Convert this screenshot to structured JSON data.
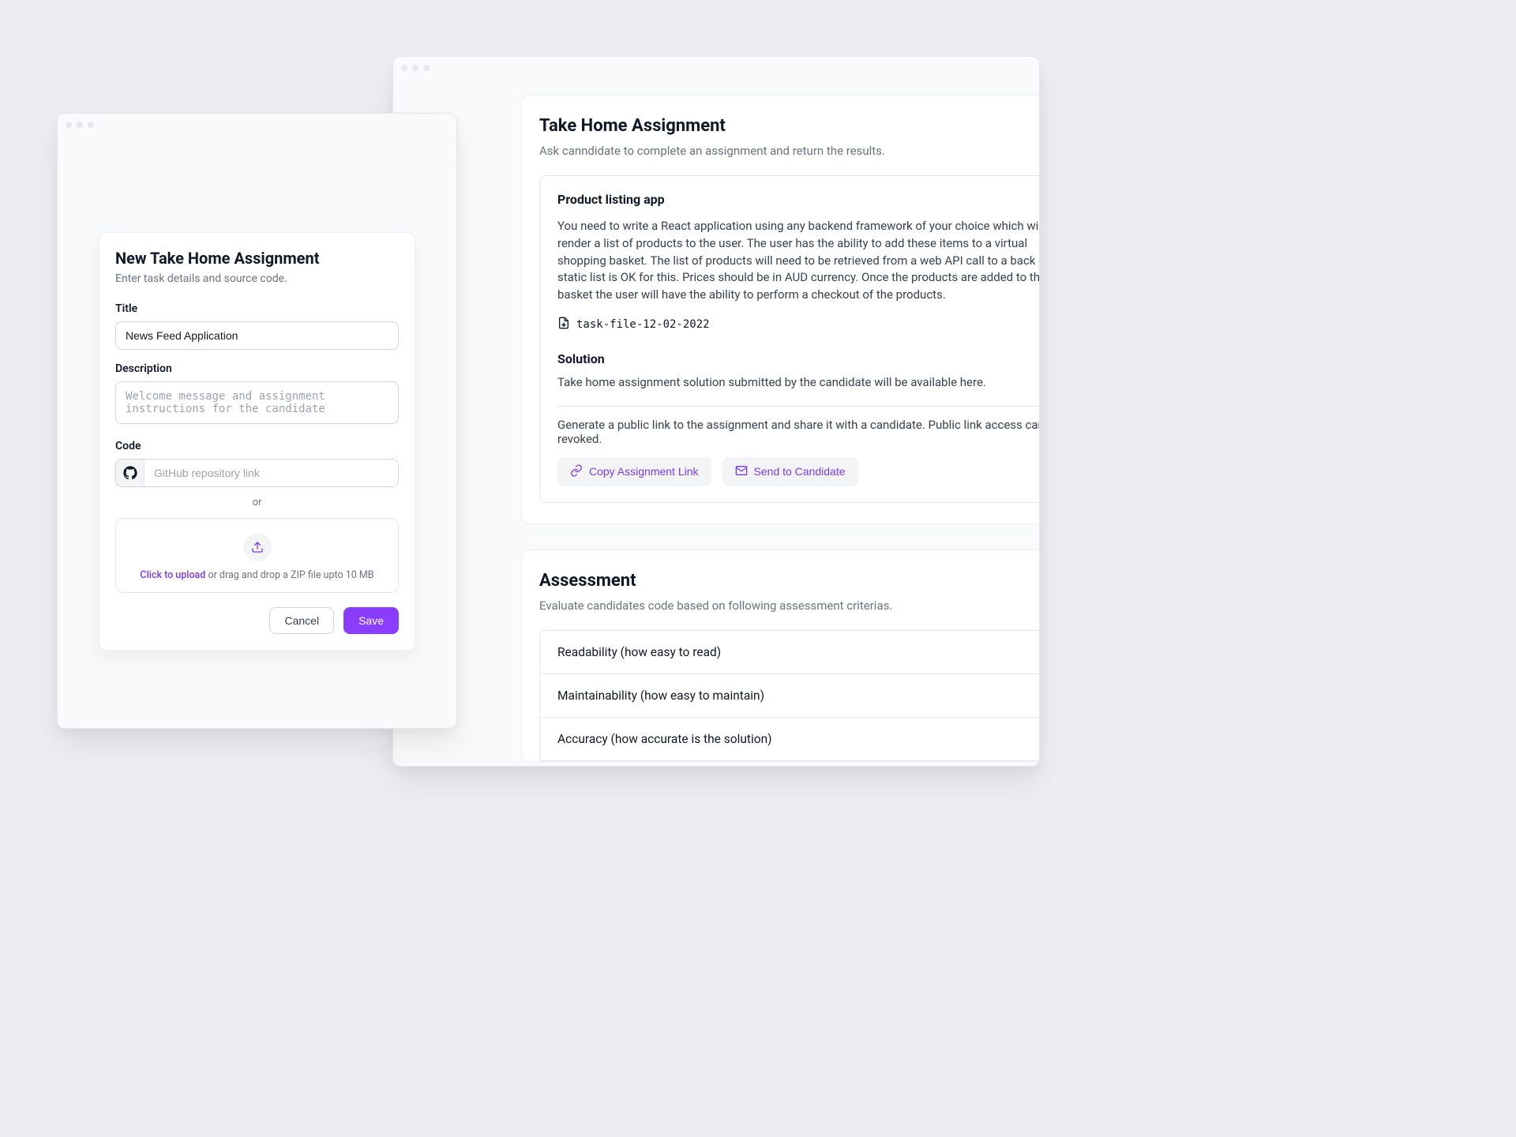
{
  "left_window": {
    "card": {
      "title": "New Take Home Assignment",
      "subtitle": "Enter task details and source code.",
      "title_field": {
        "label": "Title",
        "value": "News Feed Application"
      },
      "description_field": {
        "label": "Description",
        "placeholder": "Welcome message and assignment instructions for the candidate"
      },
      "code_field": {
        "label": "Code",
        "github_placeholder": "GitHub repository link",
        "or_text": "or",
        "upload_link_text": "Click to upload",
        "upload_rest_text": " or drag and drop a ZIP file upto 10 MB"
      },
      "buttons": {
        "cancel": "Cancel",
        "save": "Save"
      }
    }
  },
  "right_window": {
    "take_home": {
      "title": "Take Home Assignment",
      "subtitle": "Ask canndidate to complete an assignment and return the results.",
      "task_title": "Product listing app",
      "task_body": "You need to write a React application using any backend framework of your choice which will render a list of products to the user. The user has the ability to add these items to a virtual shopping basket. The list of products will need to be retrieved from a web API call to a back end. A static list is OK for this. Prices should be in AUD currency. Once the products are added to the basket the user will have the ability to perform a checkout of the products.",
      "file_name": "task-file-12-02-2022",
      "solution_label": "Solution",
      "solution_text": "Take home assignment solution submitted by the candidate will be available here.",
      "share_text": "Generate a public link to the assignment and share it with a candidate. Public link access can be revoked.",
      "copy_button": "Copy Assignment Link",
      "send_button": "Send to Candidate"
    },
    "assessment": {
      "title": "Assessment",
      "subtitle": "Evaluate candidates code based on following assessment criterias.",
      "criteria": {
        "0": "Readability (how easy to read)",
        "1": "Maintainability (how easy to maintain)",
        "2": "Accuracy (how accurate is the solution)"
      }
    }
  }
}
